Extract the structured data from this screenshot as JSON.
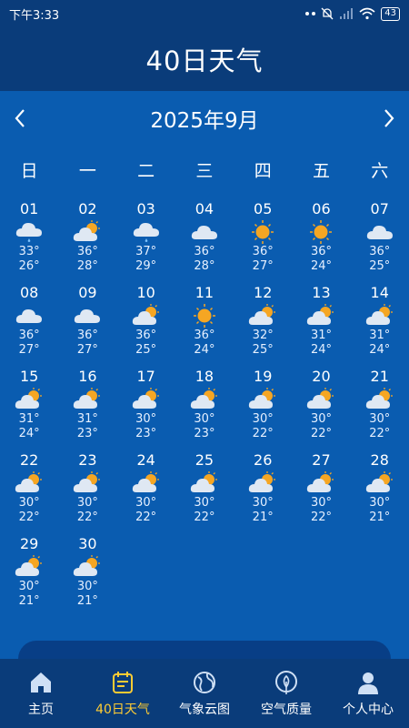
{
  "status": {
    "time": "下午3:33",
    "battery": "43"
  },
  "header": {
    "title": "40日天气"
  },
  "month": {
    "title": "2025年9月"
  },
  "weekdays": [
    "日",
    "一",
    "二",
    "三",
    "四",
    "五",
    "六"
  ],
  "days": [
    {
      "day": "01",
      "icon": "cloud-rain",
      "high": "33°",
      "low": "26°"
    },
    {
      "day": "02",
      "icon": "partly-cloudy",
      "high": "36°",
      "low": "28°"
    },
    {
      "day": "03",
      "icon": "cloud-rain",
      "high": "37°",
      "low": "29°"
    },
    {
      "day": "04",
      "icon": "cloud",
      "high": "36°",
      "low": "28°"
    },
    {
      "day": "05",
      "icon": "sun",
      "high": "36°",
      "low": "27°"
    },
    {
      "day": "06",
      "icon": "sun",
      "high": "36°",
      "low": "24°"
    },
    {
      "day": "07",
      "icon": "cloud",
      "high": "36°",
      "low": "25°"
    },
    {
      "day": "08",
      "icon": "cloud",
      "high": "36°",
      "low": "27°"
    },
    {
      "day": "09",
      "icon": "cloud",
      "high": "36°",
      "low": "27°"
    },
    {
      "day": "10",
      "icon": "partly-cloudy",
      "high": "36°",
      "low": "25°"
    },
    {
      "day": "11",
      "icon": "sun",
      "high": "36°",
      "low": "24°"
    },
    {
      "day": "12",
      "icon": "partly-cloudy",
      "high": "32°",
      "low": "25°"
    },
    {
      "day": "13",
      "icon": "partly-cloudy",
      "high": "31°",
      "low": "24°"
    },
    {
      "day": "14",
      "icon": "partly-cloudy",
      "high": "31°",
      "low": "24°"
    },
    {
      "day": "15",
      "icon": "partly-cloudy",
      "high": "31°",
      "low": "24°"
    },
    {
      "day": "16",
      "icon": "partly-cloudy",
      "high": "31°",
      "low": "23°"
    },
    {
      "day": "17",
      "icon": "partly-cloudy",
      "high": "30°",
      "low": "23°"
    },
    {
      "day": "18",
      "icon": "partly-cloudy",
      "high": "30°",
      "low": "23°"
    },
    {
      "day": "19",
      "icon": "partly-cloudy",
      "high": "30°",
      "low": "22°"
    },
    {
      "day": "20",
      "icon": "partly-cloudy",
      "high": "30°",
      "low": "22°"
    },
    {
      "day": "21",
      "icon": "partly-cloudy",
      "high": "30°",
      "low": "22°"
    },
    {
      "day": "22",
      "icon": "partly-cloudy",
      "high": "30°",
      "low": "22°"
    },
    {
      "day": "23",
      "icon": "partly-cloudy",
      "high": "30°",
      "low": "22°"
    },
    {
      "day": "24",
      "icon": "partly-cloudy",
      "high": "30°",
      "low": "22°"
    },
    {
      "day": "25",
      "icon": "partly-cloudy",
      "high": "30°",
      "low": "22°"
    },
    {
      "day": "26",
      "icon": "partly-cloudy",
      "high": "30°",
      "low": "21°"
    },
    {
      "day": "27",
      "icon": "partly-cloudy",
      "high": "30°",
      "low": "22°"
    },
    {
      "day": "28",
      "icon": "partly-cloudy",
      "high": "30°",
      "low": "21°"
    },
    {
      "day": "29",
      "icon": "partly-cloudy",
      "high": "30°",
      "low": "21°"
    },
    {
      "day": "30",
      "icon": "partly-cloudy",
      "high": "30°",
      "low": "21°"
    }
  ],
  "tabs": [
    {
      "label": "主页",
      "icon": "home-icon",
      "active": false
    },
    {
      "label": "40日天气",
      "icon": "calendar-icon",
      "active": true
    },
    {
      "label": "气象云图",
      "icon": "globe-icon",
      "active": false
    },
    {
      "label": "空气质量",
      "icon": "leaf-icon",
      "active": false
    },
    {
      "label": "个人中心",
      "icon": "user-icon",
      "active": false
    }
  ],
  "colors": {
    "background": "#0a5cb0",
    "header": "#0a3c7a",
    "active_tab": "#ffcc33",
    "sun": "#f5a623"
  }
}
